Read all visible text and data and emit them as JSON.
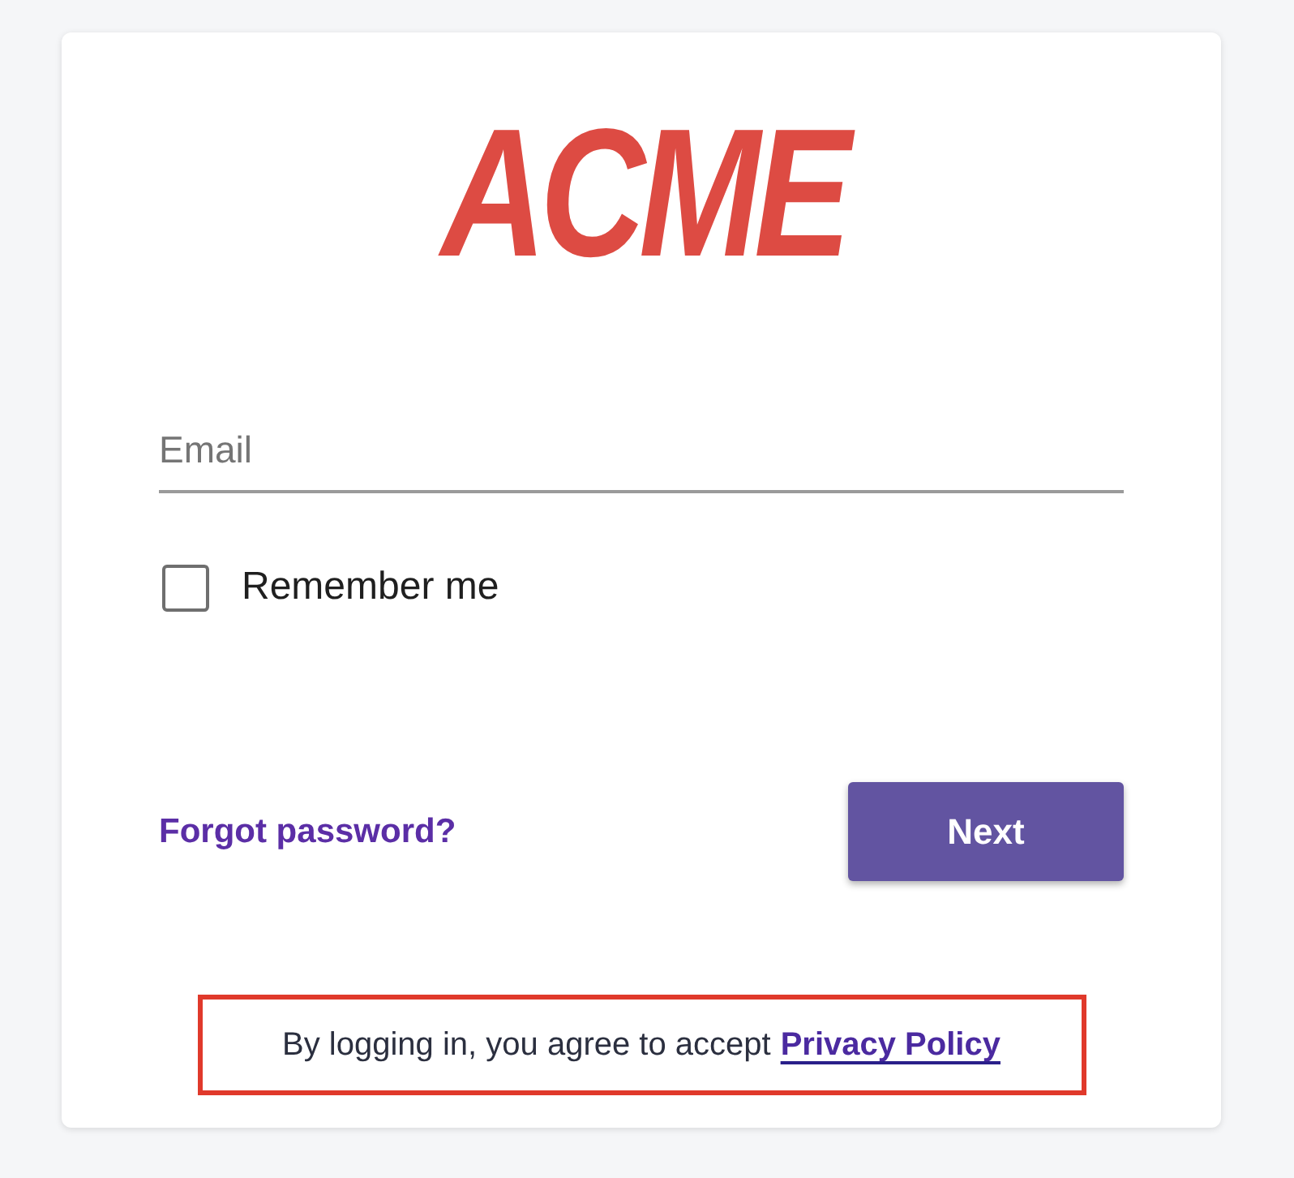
{
  "logo": {
    "text": "ACME"
  },
  "email_field": {
    "placeholder": "Email"
  },
  "remember_me": {
    "label": "Remember me",
    "checked": false
  },
  "forgot_password_link": "Forgot password?",
  "next_button": "Next",
  "footer": {
    "text": "By logging in, you agree to accept",
    "link": "Privacy Policy",
    "highlighted": true
  }
}
